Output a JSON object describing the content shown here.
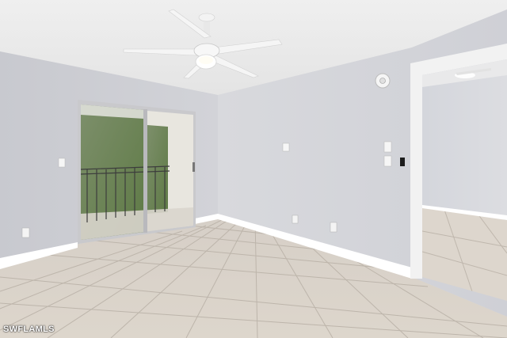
{
  "photo": {
    "watermark": "SWFLAMLS",
    "colors": {
      "ceiling": "#ececec",
      "wall_left": "#cfd0d6",
      "wall_back": "#d7d8dc",
      "wall_right": "#d2d3d9",
      "floor_tile": "#dad3ca",
      "grout": "#b9b2a8",
      "baseboard": "#ffffff",
      "door_frame": "#c9c9cc",
      "foliage": "#4d6b3a"
    },
    "objects": [
      "ceiling-fan",
      "sliding-glass-door",
      "doorway",
      "smoke-detector",
      "light-switches",
      "outlets",
      "tile-floor"
    ]
  }
}
